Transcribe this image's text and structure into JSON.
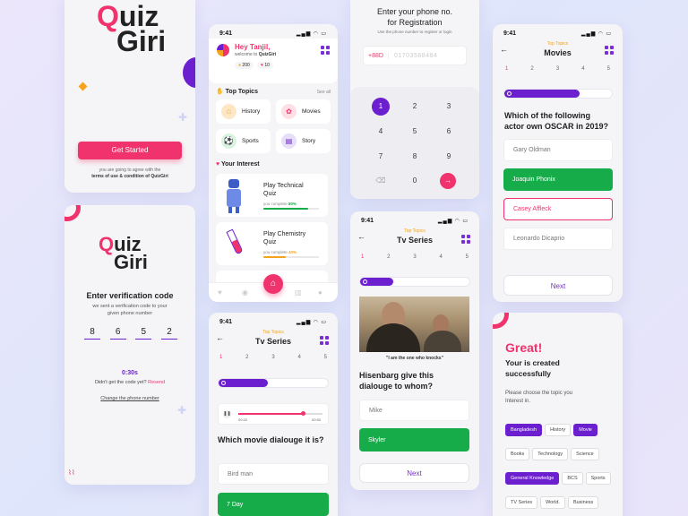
{
  "status_time": "9:41",
  "logo": {
    "q": "Q",
    "uiz": "uiz",
    "giri": "Giri"
  },
  "splash": {
    "get_started": "Get Started",
    "agree_line1": "you are going to agree with the",
    "agree_line2": "terms of use & condition of QuizGiri"
  },
  "verify": {
    "title": "Enter verification code",
    "sub1": "we sent a verification code to your",
    "sub2": "given phone number",
    "digits": [
      "8",
      "6",
      "5",
      "2"
    ],
    "timer": "0:30s",
    "didnt": "Didn't get the code yet?",
    "resend": "Resend",
    "change": "Change the phone number"
  },
  "home": {
    "greeting": "Hey Tanjil,",
    "welcome": "welcome to",
    "brand": "QuizGiri",
    "coins": "200",
    "hearts": "10",
    "top_topics": "Top Topics",
    "see_all": "See all",
    "topics": [
      "History",
      "Movies",
      "Sports",
      "Story"
    ],
    "your_interest": "Your Interest",
    "interests": [
      {
        "title1": "Play Technical",
        "title2": "Quiz",
        "complete": "you complete",
        "pct": "80%",
        "progress": 0.8
      },
      {
        "title1": "Play Chemistry",
        "title2": "Quiz",
        "complete": "you complete",
        "pct": "40%",
        "progress": 0.4
      }
    ]
  },
  "audio_q": {
    "tag": "Top Topics",
    "title": "Tv Series",
    "steps": [
      "1",
      "2",
      "3",
      "4",
      "5"
    ],
    "progress": 0.45,
    "time_start": "00:20",
    "time_end": "00:50",
    "audio_progress": 0.78,
    "question": "Which movie dialouge it is?",
    "options": [
      "Bird man",
      "7 Day"
    ]
  },
  "phone": {
    "title1": "Enter your phone no.",
    "title2": "for Registration",
    "sub": "Use the phone number to register or login",
    "code": "+88D",
    "number": "01703588484",
    "keys": [
      "1",
      "2",
      "3",
      "4",
      "5",
      "6",
      "7",
      "8",
      "9",
      "0"
    ]
  },
  "image_q": {
    "tag": "Top Topics",
    "title": "Tv Series",
    "steps": [
      "1",
      "2",
      "3",
      "4",
      "5"
    ],
    "progress": 0.3,
    "caption": "\"I am the one who knocks\"",
    "q1": "Hisenbarg give this",
    "q2": "dialouge to whom?",
    "options": [
      "Mike",
      "Skyler"
    ],
    "next": "Next"
  },
  "movies_q": {
    "tag": "Top Topics",
    "title": "Movies",
    "steps": [
      "1",
      "2",
      "3",
      "4",
      "5"
    ],
    "progress": 0.7,
    "q1": "Which of the following",
    "q2": "actor own OSCAR in 2019?",
    "options": [
      "Gary Oldman",
      "Joaquin Phonix",
      "Casey Affleck",
      "Leonardo Dicaprio"
    ],
    "next": "Next"
  },
  "created": {
    "great": "Great!",
    "line1": "Your is  created",
    "line2": "successfully",
    "choose1": "Please choose the topic you",
    "choose2": "Interest in.",
    "chips": [
      {
        "label": "Bangladesh",
        "sel": true
      },
      {
        "label": "History",
        "sel": false
      },
      {
        "label": "Movie",
        "sel": true
      },
      {
        "label": "Books",
        "sel": false
      },
      {
        "label": "Technology",
        "sel": false
      },
      {
        "label": "Science",
        "sel": false
      },
      {
        "label": "General Knowledge",
        "sel": true
      },
      {
        "label": "BCS",
        "sel": false
      },
      {
        "label": "Sports",
        "sel": false
      },
      {
        "label": "TV Series",
        "sel": false
      },
      {
        "label": "World.",
        "sel": false
      },
      {
        "label": "Business",
        "sel": false
      }
    ]
  },
  "colors": {
    "pink": "#f0336d",
    "purple": "#6c1fcf",
    "green": "#17ac4a",
    "orange": "#f5a31a"
  }
}
